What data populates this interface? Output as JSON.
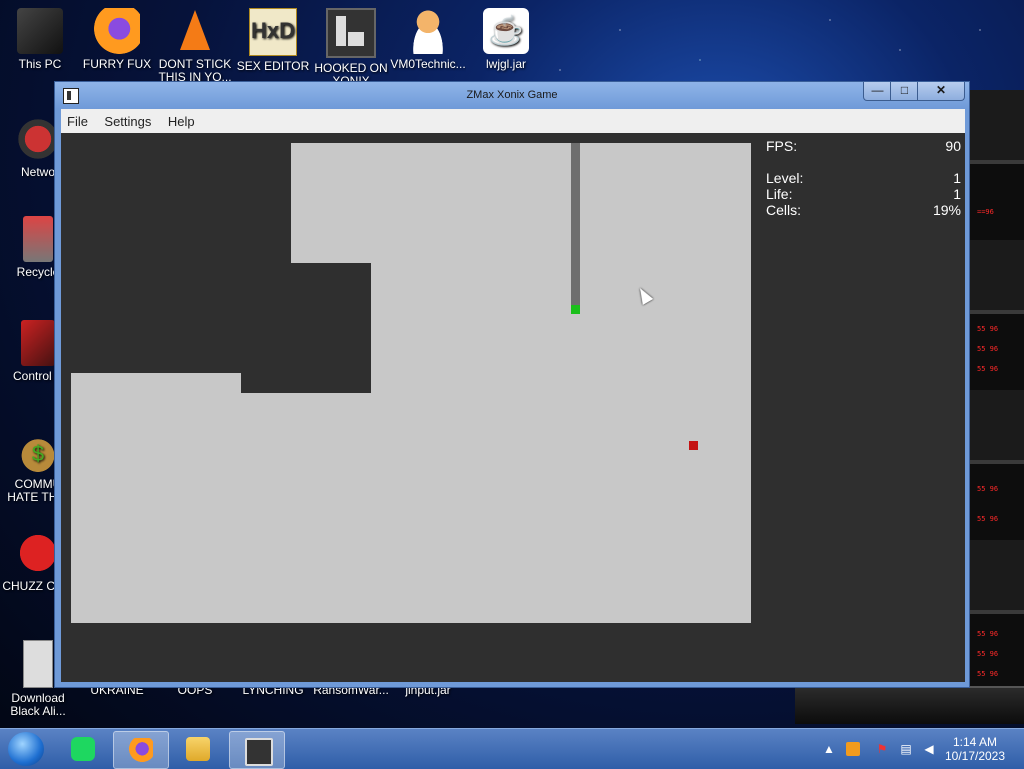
{
  "desktop": {
    "icons_top": [
      {
        "label": "This PC",
        "name": "this-pc"
      },
      {
        "label": "FURRY FUX",
        "name": "furry-fux"
      },
      {
        "label": "DONT STICK THIS IN YO...",
        "name": "dont-stick"
      },
      {
        "label": "SEX EDITOR",
        "name": "sex-editor"
      },
      {
        "label": "HOOKED ON XONIX",
        "name": "hooked-on-xonix"
      },
      {
        "label": "VM0Technic...",
        "name": "vm0technic"
      },
      {
        "label": "lwjgl.jar",
        "name": "lwjgl-jar"
      }
    ],
    "icons_left": [
      {
        "label": "Netwo",
        "name": "network"
      },
      {
        "label": "Recycle",
        "name": "recycle-bin"
      },
      {
        "label": "Control P",
        "name": "control-panel"
      },
      {
        "label": "COMMU HATE THIS",
        "name": "commu-hate-this"
      },
      {
        "label": "CHUZZ CUM",
        "name": "chuzz-cum"
      },
      {
        "label": "Download Black Ali...",
        "name": "download-black-ali"
      }
    ],
    "icons_bottom_partial": [
      "UKRAINE",
      "OOPS",
      "LYNCHING",
      "RansomWar...",
      "jinput.jar"
    ]
  },
  "window": {
    "title": "ZMax Xonix Game",
    "controls": {
      "minimize": "—",
      "maximize": "□",
      "close": "✕"
    },
    "menu": [
      "File",
      "Settings",
      "Help"
    ]
  },
  "game": {
    "stats": {
      "fps_label": "FPS:",
      "fps_value": "90",
      "level_label": "Level:",
      "level_value": "1",
      "life_label": "Life:",
      "life_value": "1",
      "cells_label": "Cells:",
      "cells_value": "19%"
    },
    "colors": {
      "captured": "#c8c8c8",
      "empty": "#2f2f2f",
      "trail": "#6e6e6e",
      "player": "#1bbf1b",
      "enemy": "#c41212"
    }
  },
  "taskbar": {
    "clock_time": "1:14 AM",
    "clock_date": "10/17/2023",
    "pinned": [
      "spotify-icon",
      "firefox-icon",
      "file-explorer-icon",
      "xonix-icon"
    ],
    "tray": [
      "show-hidden-icon",
      "sublime-icon",
      "action-center-icon",
      "network-icon",
      "volume-icon"
    ]
  }
}
